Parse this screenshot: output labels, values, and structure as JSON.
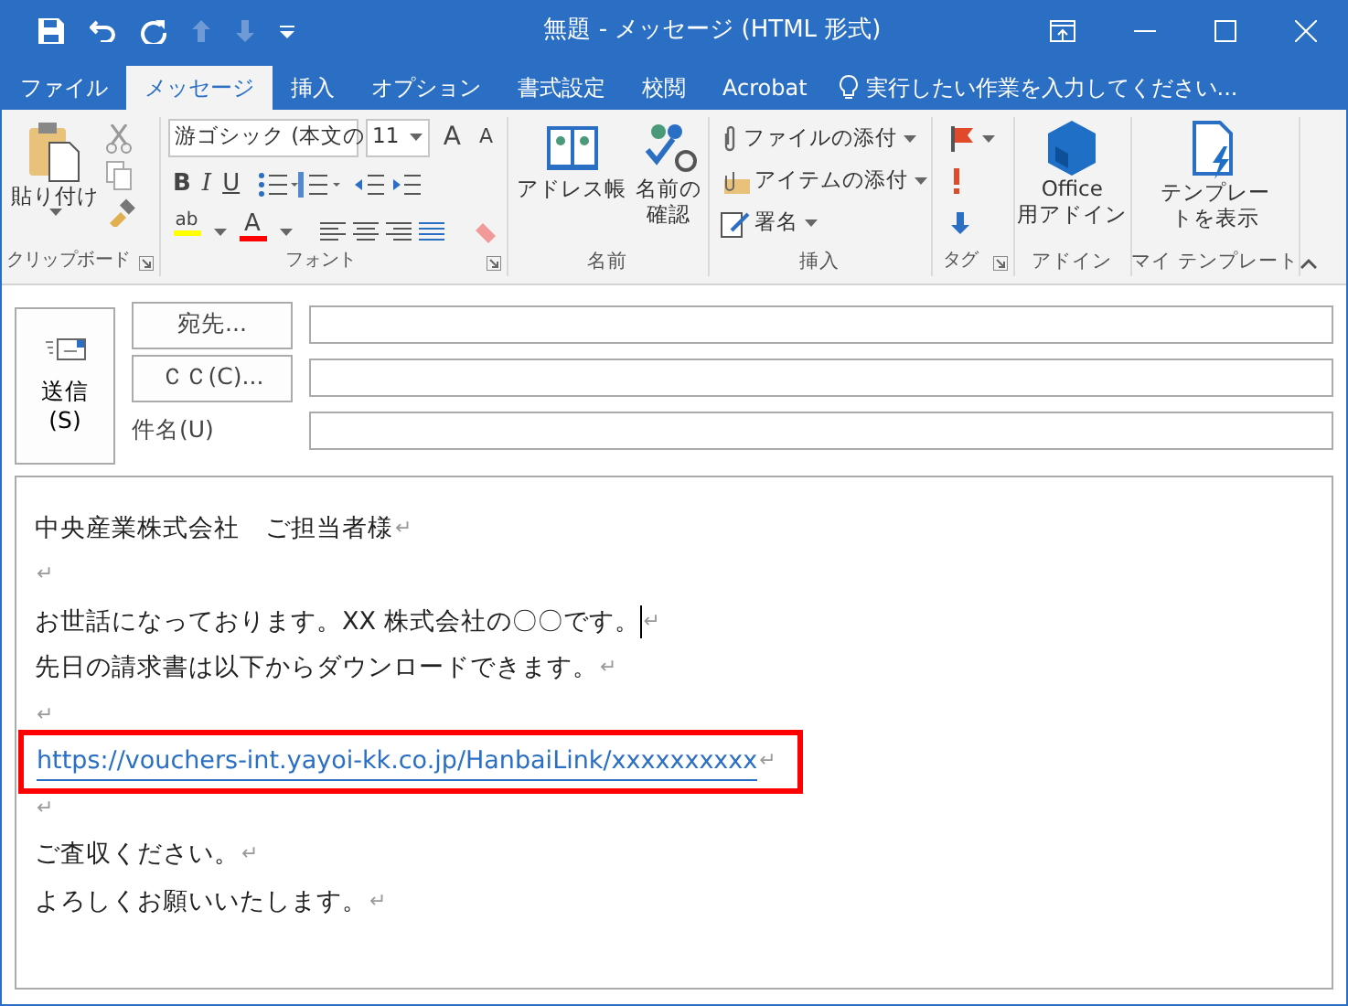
{
  "title_bar": {
    "title": "無題 - メッセージ (HTML 形式)"
  },
  "tabs": [
    {
      "label": "ファイル",
      "selected": false
    },
    {
      "label": "メッセージ",
      "selected": true
    },
    {
      "label": "挿入",
      "selected": false
    },
    {
      "label": "オプション",
      "selected": false
    },
    {
      "label": "書式設定",
      "selected": false
    },
    {
      "label": "校閲",
      "selected": false
    },
    {
      "label": "Acrobat",
      "selected": false
    }
  ],
  "tell_me": {
    "placeholder": "実行したい作業を入力してください..."
  },
  "ribbon": {
    "groups": [
      {
        "label": "クリップボード",
        "launcher": true,
        "items": [
          {
            "lines": [
              "貼り付け"
            ],
            "dropdown": true
          }
        ]
      },
      {
        "label": "フォント",
        "launcher": true,
        "font_name": "游ゴシック (本文の",
        "font_size": "11",
        "grow": "A",
        "shrink": "A",
        "bold": "B",
        "italic": "I",
        "underline": "U",
        "highlight": "ab",
        "font_color": "A"
      },
      {
        "label": "名前",
        "items": [
          {
            "lines": [
              "アドレス帳"
            ]
          },
          {
            "lines": [
              "名前の",
              "確認"
            ]
          }
        ]
      },
      {
        "label": "挿入",
        "items": [
          {
            "lines": [
              "ファイルの添付"
            ],
            "dropdown": true
          },
          {
            "lines": [
              "アイテムの添付"
            ],
            "dropdown": true
          },
          {
            "lines": [
              "署名"
            ],
            "dropdown": true
          }
        ]
      },
      {
        "label": "タグ",
        "launcher": true,
        "flag_dropdown": true
      },
      {
        "label": "アドイン",
        "items": [
          {
            "lines": [
              "Office",
              "用アドイン"
            ]
          }
        ]
      },
      {
        "label": "マイ テンプレート",
        "items": [
          {
            "lines": [
              "テンプレー",
              "トを表示"
            ]
          }
        ]
      }
    ]
  },
  "compose": {
    "send": {
      "lines": [
        "送信",
        "(S)"
      ]
    },
    "fields": [
      {
        "kind": "button",
        "label": "宛先..."
      },
      {
        "kind": "button",
        "label": "ＣＣ(C)..."
      },
      {
        "kind": "label",
        "label": "件名(U)"
      }
    ]
  },
  "body": {
    "lines": [
      {
        "kind": "text",
        "text": "中央産業株式会社　ご担当者様",
        "mark": "↵"
      },
      {
        "kind": "text",
        "mark": "↵"
      },
      {
        "kind": "text",
        "text": "お世話になっております。XX 株式会社の〇〇です。",
        "mark": "↵",
        "cursor": true
      },
      {
        "kind": "text",
        "text": "先日の請求書は以下からダウンロードできます。",
        "mark": "↵"
      },
      {
        "kind": "text",
        "mark": "↵"
      },
      {
        "kind": "link",
        "text": "https://vouchers-int.yayoi-kk.co.jp/HanbaiLink/xxxxxxxxxx",
        "mark": "↵",
        "highlighted": true
      },
      {
        "kind": "text",
        "mark": "↵"
      },
      {
        "kind": "text",
        "text": "ご査収ください。",
        "mark": "↵"
      },
      {
        "kind": "text",
        "text": "よろしくお願いいたします。",
        "mark": "↵"
      }
    ]
  }
}
